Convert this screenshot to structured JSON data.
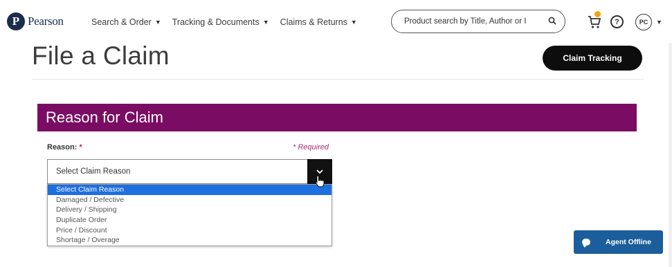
{
  "header": {
    "logo_mark": "P",
    "logo_text": "Pearson",
    "nav": [
      {
        "label": "Search & Order"
      },
      {
        "label": "Tracking & Documents"
      },
      {
        "label": "Claims & Returns"
      }
    ],
    "search_placeholder": "Product search by Title, Author or I",
    "help_glyph": "?",
    "avatar_initials": "PC",
    "cart_badge_color": "#f0a30a"
  },
  "page": {
    "title": "File a Claim",
    "claim_tracking_label": "Claim Tracking"
  },
  "section": {
    "title": "Reason for Claim",
    "color": "#7b0c63",
    "reason_label": "Reason:",
    "required_star": "*",
    "required_note": "* Required",
    "select_value": "Select Claim Reason",
    "options": [
      "Select Claim Reason",
      "Damaged / Defective",
      "Delivery / Shipping",
      "Duplicate Order",
      "Price / Discount",
      "Shortage / Overage"
    ],
    "selected_option_index": 0
  },
  "chat": {
    "label": "Agent Offline",
    "color": "#1b5e9b"
  }
}
